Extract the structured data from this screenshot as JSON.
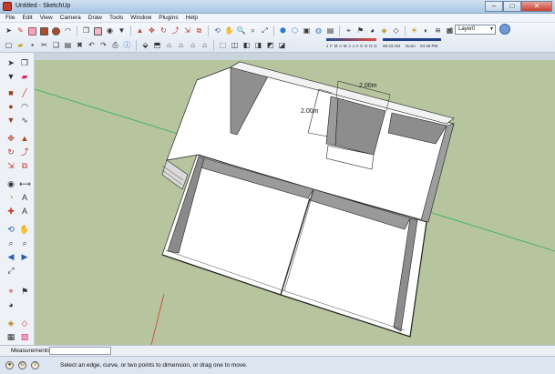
{
  "window": {
    "title": "Untitled - SketchUp",
    "minimize": "–",
    "maximize": "□",
    "close": "✕"
  },
  "menu": [
    "File",
    "Edit",
    "View",
    "Camera",
    "Draw",
    "Tools",
    "Window",
    "Plugins",
    "Help"
  ],
  "layers": {
    "current": "Layer0",
    "active_mark": "✓"
  },
  "shadows": {
    "month_labels": [
      "J",
      "F",
      "M",
      "A",
      "M",
      "J",
      "J",
      "A",
      "S",
      "O",
      "N",
      "D"
    ],
    "sunrise": "06:43 AM",
    "noon": "Noon",
    "sunset": "04:46 PM"
  },
  "model": {
    "dimension_horizontal": "2.00m",
    "dimension_vertical": "2.00m"
  },
  "measurements": {
    "label": "Measurements",
    "value": ""
  },
  "status": {
    "message": "Select an edge, curve, or two points to dimension, or drag one to move."
  },
  "colors": {
    "sky": "#cad4dd",
    "ground": "#b6c59e",
    "wall_top": "#ffffff",
    "wall_inner": "#8f8f8f",
    "axis_green": "#2bb34a",
    "axis_red": "#d03a2a",
    "accent": "#a9c6e3"
  },
  "icons": {
    "select": "arrow-icon",
    "pencil": "pencil-icon",
    "eraser": "eraser-icon",
    "paint": "paint-bucket-icon",
    "orbit": "orbit-icon",
    "zoom": "magnifier-icon",
    "walk": "footprints-icon",
    "close": "close-icon"
  }
}
